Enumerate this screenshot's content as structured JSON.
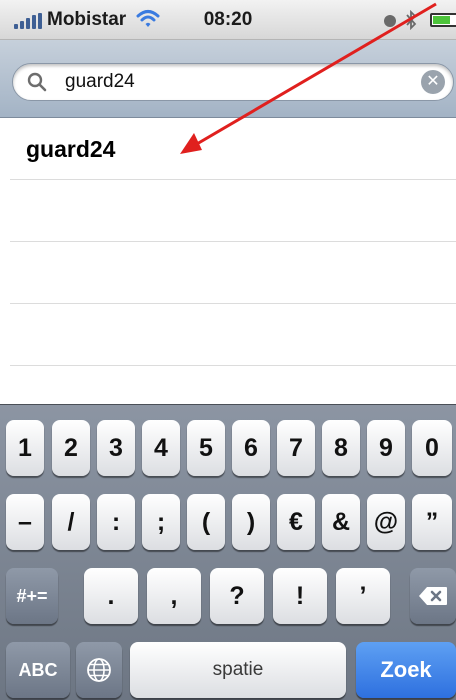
{
  "status_bar": {
    "carrier": "Mobistar",
    "time": "08:20",
    "battery_level": 0.7
  },
  "search": {
    "value": "guard24",
    "icon": "search-icon",
    "clear_icon": "clear-icon"
  },
  "results": [
    {
      "label": "guard24"
    },
    {
      "label": ""
    },
    {
      "label": ""
    },
    {
      "label": ""
    }
  ],
  "keyboard": {
    "row1": [
      "1",
      "2",
      "3",
      "4",
      "5",
      "6",
      "7",
      "8",
      "9",
      "0"
    ],
    "row2": [
      "–",
      "/",
      ":",
      ";",
      "(",
      ")",
      "€",
      "&",
      "@",
      "”"
    ],
    "row3": {
      "shift": "#+=",
      "keys": [
        ".",
        ",",
        "?",
        "!",
        "’"
      ],
      "delete_icon": "backspace-icon"
    },
    "row4": {
      "mode": "ABC",
      "globe_icon": "globe-icon",
      "space": "spatie",
      "action": "Zoek"
    }
  },
  "colors": {
    "annotation_arrow": "#e0201e",
    "action_key": "#2e70df"
  }
}
